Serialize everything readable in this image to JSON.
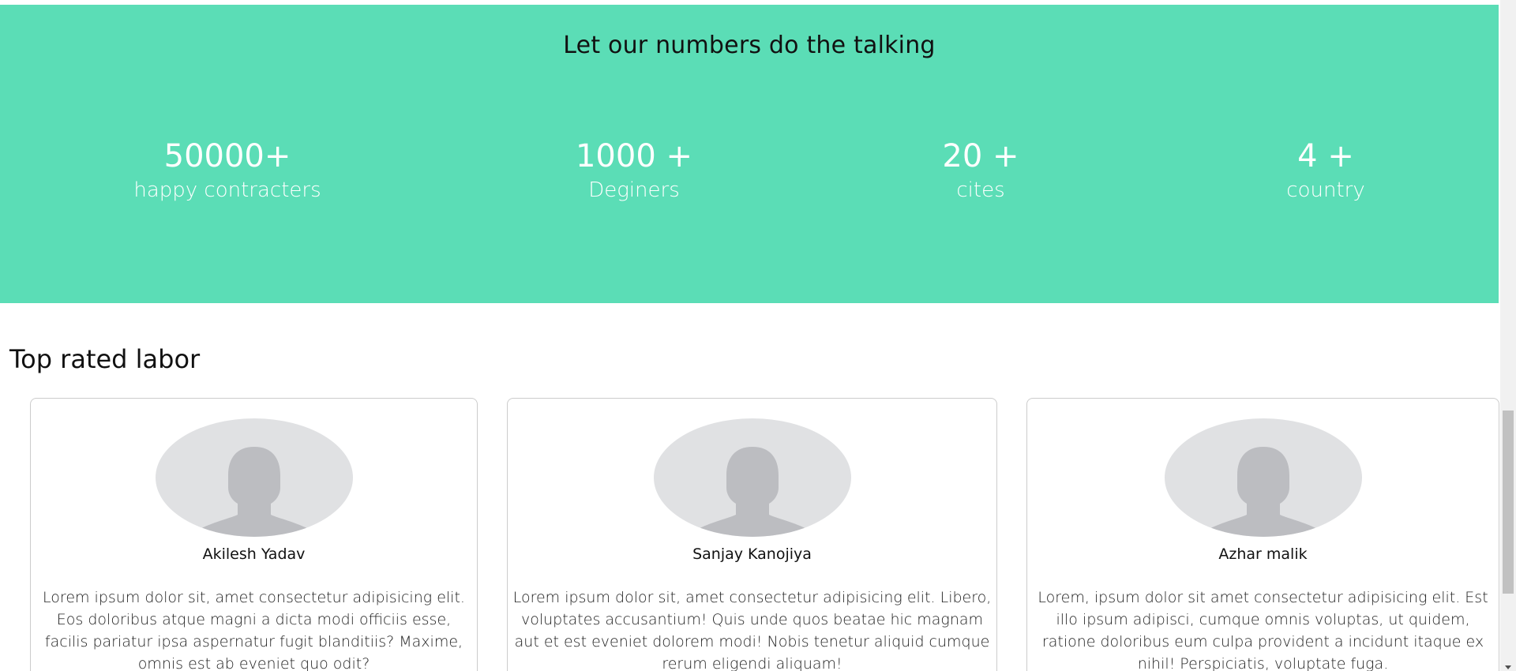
{
  "stats": {
    "heading": "Let our numbers do the talking",
    "items": [
      {
        "value": "50000+",
        "label": "happy contracters"
      },
      {
        "value": "1000 +",
        "label": "Deginers"
      },
      {
        "value": "20 +",
        "label": "cites"
      },
      {
        "value": "4 +",
        "label": "country"
      }
    ],
    "background": "#5bddb6"
  },
  "labor": {
    "title": "Top rated labor",
    "cards": [
      {
        "avatar_icon": "person-placeholder-icon",
        "name": "Akilesh Yadav",
        "text": "Lorem ipsum dolor sit, amet consectetur adipisicing elit. Eos doloribus atque magni a dicta modi officiis esse, facilis pariatur ipsa aspernatur fugit blanditiis? Maxime, omnis est ab eveniet quo odit?"
      },
      {
        "avatar_icon": "person-placeholder-icon",
        "name": "Sanjay Kanojiya",
        "text": "Lorem ipsum dolor sit, amet consectetur adipisicing elit. Libero, voluptates accusantium! Quis unde quos beatae hic magnam aut et est eveniet dolorem modi! Nobis tenetur aliquid cumque rerum eligendi aliquam!"
      },
      {
        "avatar_icon": "person-placeholder-icon",
        "name": "Azhar malik",
        "text": "Lorem, ipsum dolor sit amet consectetur adipisicing elit. Est illo ipsum adipisci, cumque omnis voluptas, ut quidem, ratione doloribus eum culpa provident a incidunt itaque ex nihil! Perspiciatis, voluptate fuga."
      }
    ]
  }
}
